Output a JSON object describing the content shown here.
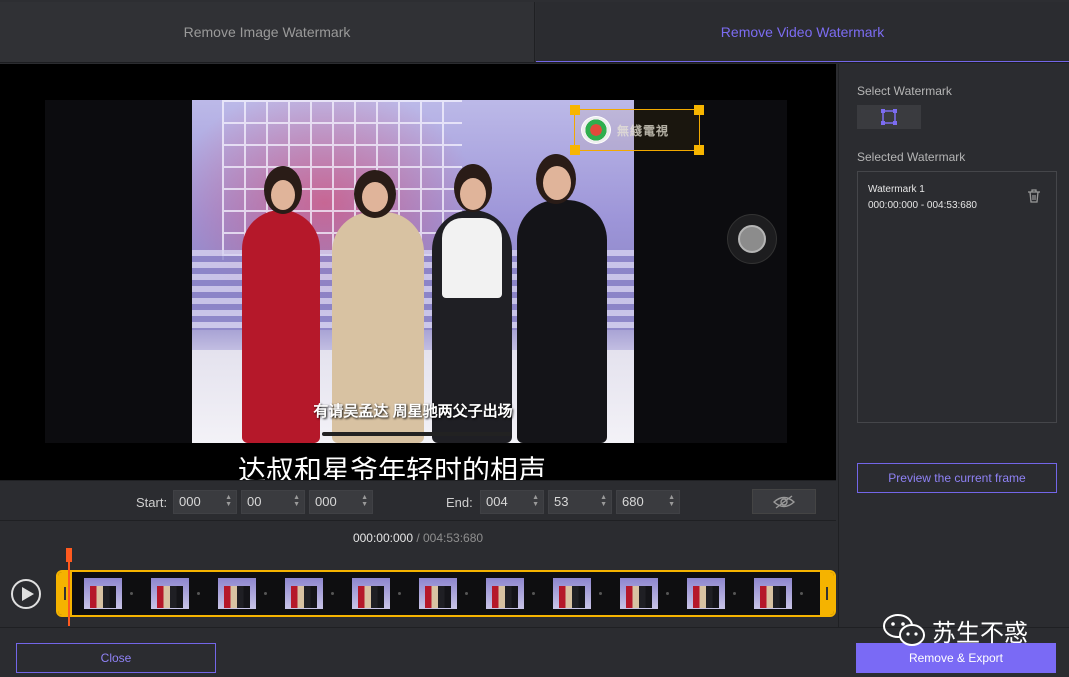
{
  "tabs": {
    "image": "Remove Image Watermark",
    "video": "Remove Video Watermark"
  },
  "video": {
    "inner_subtitle": "有请吴孟达 周星驰两父子出场",
    "outer_subtitle": "达叔和星爷年轻时的相声",
    "watermark_logo_text": "無綫電視"
  },
  "time": {
    "start_label": "Start:",
    "start_h": "000",
    "start_m": "00",
    "start_ms": "000",
    "end_label": "End:",
    "end_h": "004",
    "end_m": "53",
    "end_ms": "680",
    "current": "000:00:000",
    "total": " / 004:53:680"
  },
  "panel": {
    "select_label": "Select Watermark",
    "selected_label": "Selected Watermark",
    "item_name": "Watermark  1",
    "item_range": "000:00:000 - 004:53:680",
    "preview_label": "Preview the current frame"
  },
  "bottom": {
    "close_label": "Close",
    "export_label": "Remove & Export",
    "brand_text": "苏生不惑"
  },
  "colors": {
    "accent": "#7a6af5",
    "timeline_border": "#f5b300",
    "playhead": "#ff5a1f"
  }
}
